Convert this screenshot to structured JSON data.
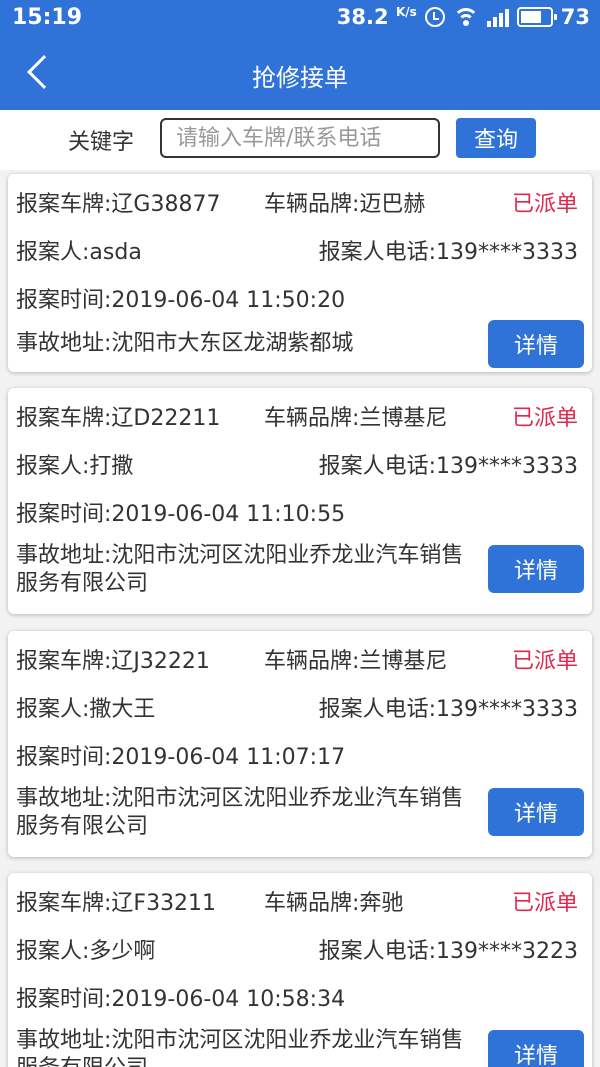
{
  "status_bar": {
    "time": "15:19",
    "speed": "38.2",
    "speed_unit": "K/s",
    "battery": "73"
  },
  "header": {
    "title": "抢修接单"
  },
  "search": {
    "label": "关键字",
    "placeholder": "请输入车牌/联系电话",
    "button_label": "查询"
  },
  "orders": [
    {
      "plate": "报案车牌:辽G38877",
      "brand": "车辆品牌:迈巴赫",
      "status": "已派单",
      "reporter": "报案人:asda",
      "phone": "报案人电话:139****3333",
      "time": "报案时间:2019-06-04 11:50:20",
      "address": "事故地址:沈阳市大东区龙湖紫都城",
      "detail_label": "详情"
    },
    {
      "plate": "报案车牌:辽D22211",
      "brand": "车辆品牌:兰博基尼",
      "status": "已派单",
      "reporter": "报案人:打撒",
      "phone": "报案人电话:139****3333",
      "time": "报案时间:2019-06-04 11:10:55",
      "address": "事故地址:沈阳市沈河区沈阳业乔龙业汽车销售服务有限公司",
      "detail_label": "详情"
    },
    {
      "plate": "报案车牌:辽J32221",
      "brand": "车辆品牌:兰博基尼",
      "status": "已派单",
      "reporter": "报案人:撒大王",
      "phone": "报案人电话:139****3333",
      "time": "报案时间:2019-06-04 11:07:17",
      "address": "事故地址:沈阳市沈河区沈阳业乔龙业汽车销售服务有限公司",
      "detail_label": "详情"
    },
    {
      "plate": "报案车牌:辽F33211",
      "brand": "车辆品牌:奔驰",
      "status": "已派单",
      "reporter": "报案人:多少啊",
      "phone": "报案人电话:139****3223",
      "time": "报案时间:2019-06-04 10:58:34",
      "address": "事故地址:沈阳市沈河区沈阳业乔龙业汽车销售服务有限公司",
      "detail_label": "详情"
    }
  ]
}
